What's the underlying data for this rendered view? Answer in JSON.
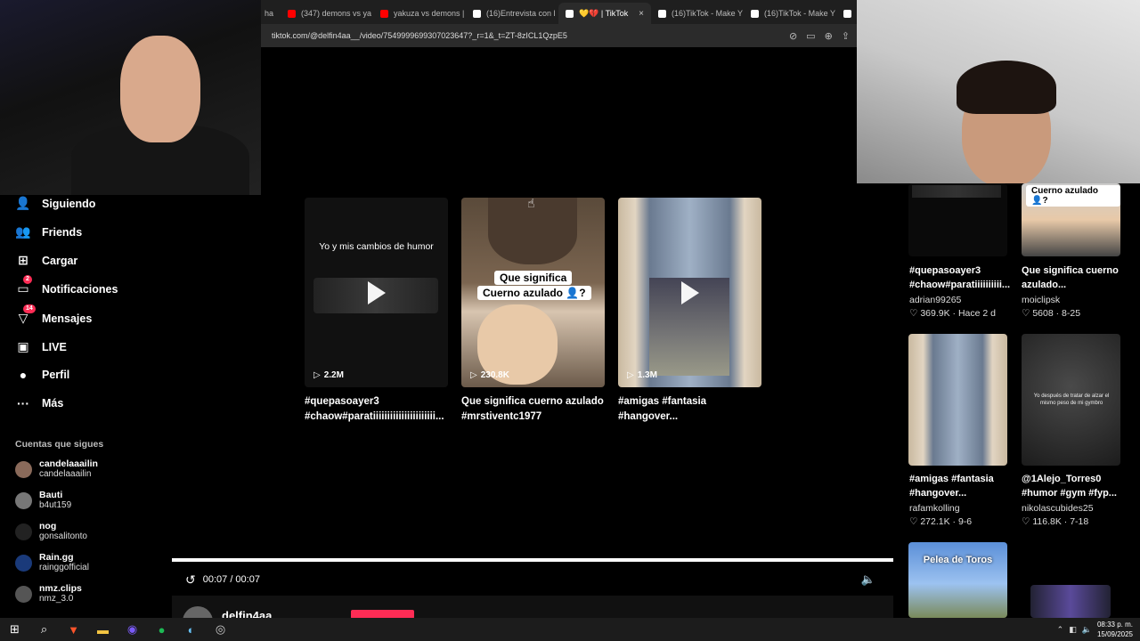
{
  "browser": {
    "tabs": [
      {
        "label": "ha",
        "color": "#888888",
        "active": false
      },
      {
        "label": "(347) demons vs ya",
        "color": "#ff0000",
        "active": false
      },
      {
        "label": "yakuza vs demons |",
        "color": "#ff0000",
        "active": false
      },
      {
        "label": "(16)Entrevista con l",
        "color": "#ffffff",
        "active": false
      },
      {
        "label": "💛💔 | TikTok",
        "color": "#ffffff",
        "active": true
      },
      {
        "label": "(16)TikTok - Make Y",
        "color": "#ffffff",
        "active": false
      },
      {
        "label": "(16)TikTok - Make Y",
        "color": "#ffffff",
        "active": false
      },
      {
        "label": "(1",
        "color": "#ffffff",
        "active": false
      }
    ],
    "close_glyph": "×",
    "url": "tiktok.com/@delfin4aa__/video/7549999699307023647?_r=1&_t=ZT-8zICL1QzpE5"
  },
  "sidebar": {
    "items": [
      {
        "label": "Siguiendo",
        "icon": "following-icon",
        "glyph": "👤",
        "badge": ""
      },
      {
        "label": "Friends",
        "icon": "friends-icon",
        "glyph": "👥",
        "badge": ""
      },
      {
        "label": "Cargar",
        "icon": "upload-icon",
        "glyph": "⊞",
        "badge": ""
      },
      {
        "label": "Notificaciones",
        "icon": "notifications-icon",
        "glyph": "▭",
        "badge": "2"
      },
      {
        "label": "Mensajes",
        "icon": "messages-icon",
        "glyph": "▽",
        "badge": "14"
      },
      {
        "label": "LIVE",
        "icon": "live-icon",
        "glyph": "▣",
        "badge": ""
      },
      {
        "label": "Perfil",
        "icon": "profile-icon",
        "glyph": "●",
        "badge": ""
      },
      {
        "label": "Más",
        "icon": "more-icon",
        "glyph": "···",
        "badge": ""
      }
    ],
    "following_title": "Cuentas que sigues",
    "accounts": [
      {
        "name": "candelaaailin",
        "handle": "candelaaailin"
      },
      {
        "name": "Bauti",
        "handle": "b4ut159"
      },
      {
        "name": "nog",
        "handle": "gonsalitonto"
      },
      {
        "name": "Rain.gg",
        "handle": "rainggofficial"
      },
      {
        "name": "nmz.clips",
        "handle": "nmz_3.0"
      }
    ]
  },
  "grid": [
    {
      "views": "2.2M",
      "caption1": "#quepasoayer3",
      "caption2": "#chaow#paratiiiiiiiiiiiiiiiiiiiiii...",
      "overlay": "Yo y mis cambios de humor"
    },
    {
      "views": "230.8K",
      "caption1": "Que significa cuerno azulado",
      "caption2": "#mrstiventc1977",
      "overlay": "Que significa",
      "overlay2": "Cuerno azulado 👤?"
    },
    {
      "views": "1.3M",
      "caption1": "#amigas #fantasia",
      "caption2": "#hangover...",
      "overlay": ""
    }
  ],
  "right": [
    {
      "caption1": "#quepasoayer3",
      "caption2": "#chaow#paratiiiiiiiiii...",
      "author": "adrian99265",
      "likes": "369.9K",
      "date": "Hace 2 d"
    },
    {
      "caption1": "Que significa cuerno",
      "caption2": "azulado...",
      "author": "moiclipsk",
      "likes": "5608",
      "date": "8-25",
      "overlay": "Cuerno azulado 👤?"
    },
    {
      "caption1": "#amigas #fantasia",
      "caption2": "#hangover...",
      "author": "rafamkolling",
      "likes": "272.1K",
      "date": "9-6"
    },
    {
      "caption1": "@1Alejo_Torres0",
      "caption2": "#humor #gym #fyp...",
      "author": "nikolascubides25",
      "likes": "116.8K",
      "date": "7-18",
      "overlay": "Yo después de tratar de alzar el mismo peso de mi gymbro"
    },
    {
      "overlay": "Pelea de Toros"
    }
  ],
  "player": {
    "time": "00:07 / 00:07",
    "author": "delfin4aa"
  },
  "taskbar": {
    "time": "08:33 p. m.",
    "date": "15/09/2025"
  },
  "colors": {
    "accent": "#fe2c55",
    "bg": "#000000"
  }
}
